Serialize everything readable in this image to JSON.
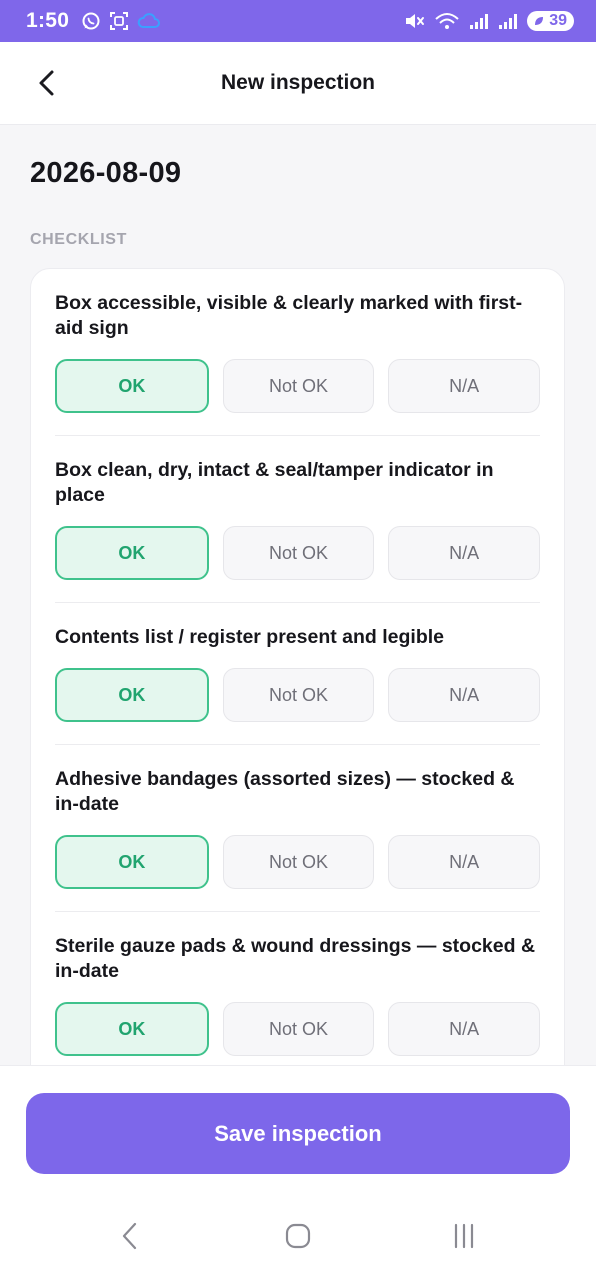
{
  "status_bar": {
    "time": "1:50",
    "battery_level": "39",
    "icons": [
      "whatsapp-icon",
      "screenshot-icon",
      "cloud-icon",
      "mute-icon",
      "wifi-icon",
      "signal-icon",
      "signal-icon",
      "battery-icon"
    ]
  },
  "header": {
    "title": "New inspection",
    "back_icon": "chevron-left-icon"
  },
  "inspection": {
    "date": "2026-08-09",
    "section_label": "CHECKLIST"
  },
  "checklist": [
    {
      "text": "Box accessible, visible & clearly marked with first-aid sign",
      "options": [
        "OK",
        "Not OK",
        "N/A"
      ],
      "selected": "OK"
    },
    {
      "text": "Box clean, dry, intact & seal/tamper indicator in place",
      "options": [
        "OK",
        "Not OK",
        "N/A"
      ],
      "selected": "OK"
    },
    {
      "text": "Contents list / register present and legible",
      "options": [
        "OK",
        "Not OK",
        "N/A"
      ],
      "selected": "OK"
    },
    {
      "text": "Adhesive bandages (assorted sizes) — stocked & in-date",
      "options": [
        "OK",
        "Not OK",
        "N/A"
      ],
      "selected": "OK"
    },
    {
      "text": "Sterile gauze pads & wound dressings — stocked & in-date",
      "options": [
        "OK",
        "Not OK",
        "N/A"
      ],
      "selected": "OK"
    }
  ],
  "footer": {
    "save_label": "Save inspection"
  },
  "nav_bar": {
    "icons": [
      "back-nav-icon",
      "home-nav-icon",
      "recents-nav-icon"
    ]
  },
  "colors": {
    "accent": "#7d67ea",
    "selected_border": "#3fc28c",
    "selected_bg": "#e4f7ee",
    "selected_text": "#21a46f"
  }
}
